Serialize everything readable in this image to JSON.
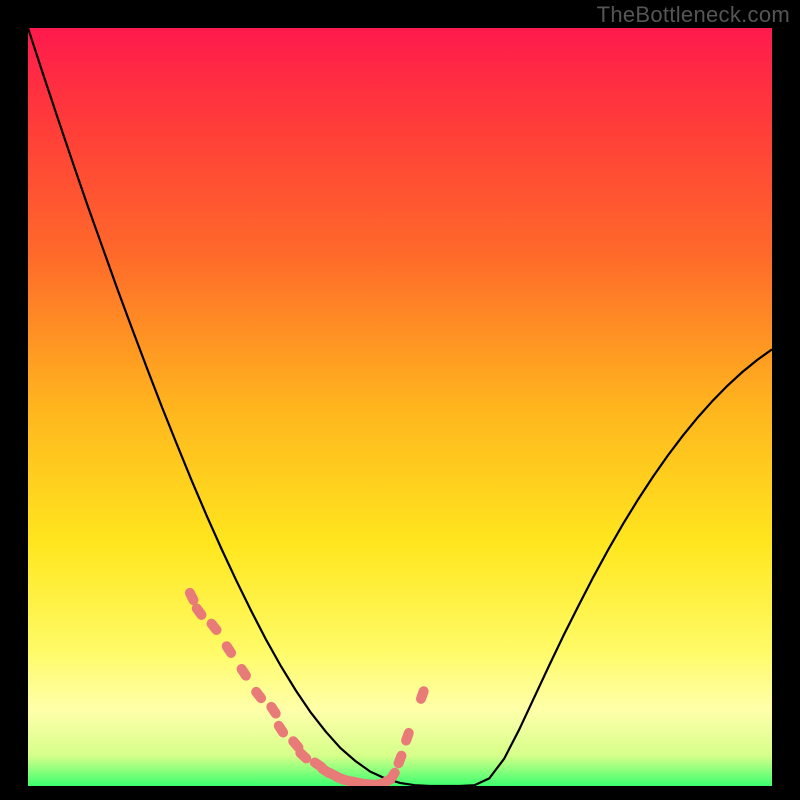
{
  "watermark": "TheBottleneck.com",
  "chart_data": {
    "type": "line",
    "title": "",
    "xlabel": "",
    "ylabel": "",
    "x": [
      0.0,
      0.02,
      0.04,
      0.06,
      0.08,
      0.1,
      0.12,
      0.14,
      0.16,
      0.18,
      0.2,
      0.22,
      0.24,
      0.26,
      0.28,
      0.3,
      0.32,
      0.34,
      0.36,
      0.38,
      0.4,
      0.42,
      0.44,
      0.46,
      0.48,
      0.5,
      0.52,
      0.54,
      0.56,
      0.58,
      0.6,
      0.62,
      0.64,
      0.66,
      0.68,
      0.7,
      0.72,
      0.74,
      0.76,
      0.78,
      0.8,
      0.82,
      0.84,
      0.86,
      0.88,
      0.9,
      0.92,
      0.94,
      0.96,
      0.98,
      1.0
    ],
    "values": [
      1.0,
      0.94,
      0.881,
      0.823,
      0.766,
      0.711,
      0.656,
      0.603,
      0.551,
      0.5,
      0.451,
      0.403,
      0.357,
      0.313,
      0.271,
      0.231,
      0.193,
      0.158,
      0.126,
      0.097,
      0.072,
      0.05,
      0.033,
      0.019,
      0.01,
      0.004,
      0.001,
      0.0,
      0.0,
      0.0,
      0.001,
      0.01,
      0.036,
      0.074,
      0.116,
      0.158,
      0.199,
      0.238,
      0.276,
      0.312,
      0.346,
      0.378,
      0.408,
      0.436,
      0.462,
      0.486,
      0.508,
      0.528,
      0.546,
      0.562,
      0.576
    ],
    "xlim": [
      0,
      1
    ],
    "ylim": [
      0,
      1
    ],
    "markers": {
      "x": [
        0.22,
        0.23,
        0.25,
        0.27,
        0.29,
        0.31,
        0.33,
        0.34,
        0.36,
        0.37,
        0.39,
        0.4,
        0.41,
        0.42,
        0.43,
        0.44,
        0.45,
        0.46,
        0.47,
        0.48,
        0.49,
        0.5,
        0.51,
        0.53
      ],
      "y": [
        0.25,
        0.23,
        0.21,
        0.18,
        0.15,
        0.12,
        0.1,
        0.075,
        0.055,
        0.04,
        0.028,
        0.02,
        0.015,
        0.01,
        0.007,
        0.005,
        0.003,
        0.002,
        0.002,
        0.005,
        0.013,
        0.035,
        0.065,
        0.12
      ]
    },
    "gradient_stops": [
      {
        "offset": 0.0,
        "color": "#ff1a4d"
      },
      {
        "offset": 0.12,
        "color": "#ff3a3a"
      },
      {
        "offset": 0.3,
        "color": "#ff6a2a"
      },
      {
        "offset": 0.5,
        "color": "#ffb51e"
      },
      {
        "offset": 0.68,
        "color": "#ffe61e"
      },
      {
        "offset": 0.82,
        "color": "#fffb66"
      },
      {
        "offset": 0.9,
        "color": "#ffffaa"
      },
      {
        "offset": 0.96,
        "color": "#d6ff8a"
      },
      {
        "offset": 1.0,
        "color": "#3cff6e"
      }
    ]
  },
  "colors": {
    "background": "#000000",
    "curve": "#000000",
    "marker": "#e87a77",
    "watermark": "#555555"
  }
}
